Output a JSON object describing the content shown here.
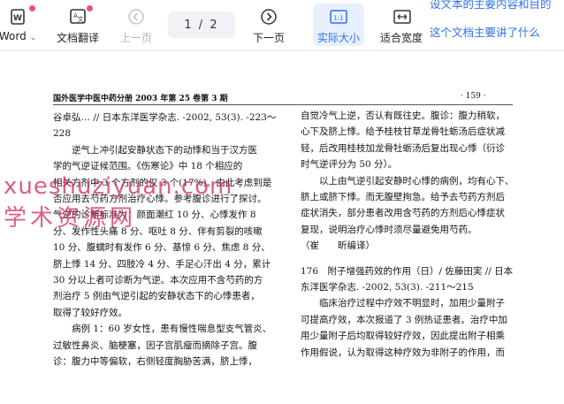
{
  "toolbar": {
    "word_label": "Word",
    "translate_label": "文档翻译",
    "prev_label": "上一页",
    "page_indicator": "1 / 2",
    "next_label": "下一页",
    "actual_size_label": "实际大小",
    "fit_width_label": "适合宽度",
    "actual_size_icon_text": "1:1",
    "colors": {
      "accent": "#2f6ff0",
      "active_bg": "#e8f0ff",
      "notify_dot": "#f0506e"
    }
  },
  "chat_suggestions": [
    "设文本的主要内容和目的",
    "这个文档主要讲了什么"
  ],
  "document": {
    "header_left": "国外医学中医中药分册 2003 年第 25 卷第 3 期",
    "page_number": "· 159 ·",
    "left_column": [
      "谷卓弘… // 日本东洋医学杂志. -2002, 53(3). -223～",
      "228",
      "　　逆气上冲引起安静状态下的动悸和当于汉方医",
      "学的气逆证候范围。《伤寒论》中 18 个相应的",
      "相关方剂中 3 个方剂的仅 3 个(17%)。由此考虑到是",
      "否应用去芍药方剂治疗心悸。参考腹诊进行了探讨。",
      "气逆的诊断标准为：颜面潮红 10 分、心悸发作 8",
      "分、发作性头痛 8 分、呕吐 8 分、伴有剪裂的咳嗽",
      "10 分、腹蠕时有发作 6 分、基惊 6 分、焦虑 8 分、",
      "脐上悸 14 分、四肢冷 4 分、手足心汗出 4 分，累计",
      "30 分以上者可诊断为气逆。本次应用不含芍药的方",
      "剂治疗 5 例由气逆引起的安静状态下的心悸患者，",
      "取得了较好疗效。",
      "　　病例 1：60 岁女性，患有慢性喘息型支气管炎、",
      "过敏性鼻炎、脑梗塞，因子宫肌瘤而摘除子宫。腹",
      "诊：腹力中等偏软，右侧轻度胸胁苦满，脐上悸，"
    ],
    "right_column": [
      "自觉冷气上逆，否认有既往史。腹诊：腹力稍软，",
      "心下及脐上悸。给予桂枝甘草龙骨牡蛎汤后症状减",
      "轻，后改用桂枝加龙骨牡蛎汤后复出现心悸（衍诊",
      "时气逆评分为 50 分）。",
      "　　以上由气逆引起安静时心悸的病例，均有心下、",
      "脐上或脐下悸。而无腹壁拘急。给予去芍药方剂后",
      "症状消失，部分患者改用含芍药的方剂后心悸症状",
      "复现，说明治疗心悸时须尽量避免用芍药。",
      "（崔　　昕编译）",
      "",
      "176　附子增强药效的作用（日）/ 佐藤田実 // 日本",
      "东洋医学杂志. -2002, 53(3). -211～215",
      "　　临床治疗过程中疗效不明显时，加用少量附子",
      "可提高疗效，本次报道了 3 例热证患者。治疗中加",
      "用少量附子后均取得较好疗效，因此提出附子相乘",
      "作用假说，认为取得这种疗效为非附子的作用，而"
    ]
  },
  "watermark": {
    "line1": "xueshuziyuan.com",
    "line2": "学术资源网"
  }
}
